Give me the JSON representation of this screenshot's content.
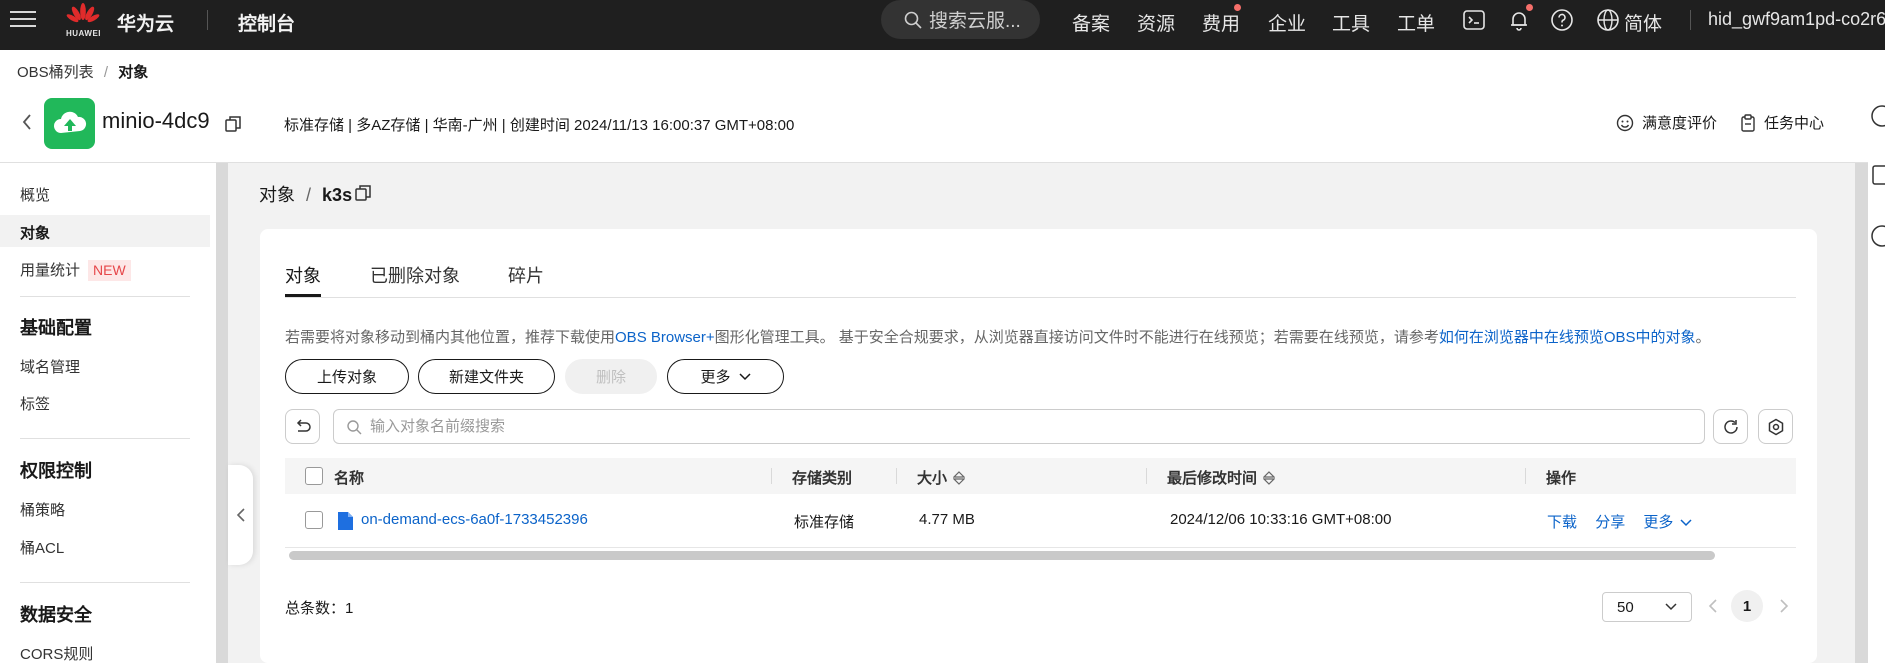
{
  "topbar": {
    "logo_text": "HUAWEI",
    "brand": "华为云",
    "console": "控制台",
    "search_placeholder": "搜索云服...",
    "nav": [
      "备案",
      "资源",
      "费用",
      "企业",
      "工具",
      "工单"
    ],
    "language": "简体",
    "user": "hid_gwf9am1pd-co2r6"
  },
  "breadcrumb": {
    "parent": "OBS桶列表",
    "separator": "/",
    "current": "对象"
  },
  "bucket": {
    "name": "minio-4dc9",
    "meta": "标准存储 | 多AZ存储 | 华南-广州 | 创建时间  2024/11/13 16:00:37 GMT+08:00",
    "satisfaction": "满意度评价",
    "task_center": "任务中心"
  },
  "sidebar": {
    "overview": "概览",
    "objects": "对象",
    "usage": "用量统计",
    "usage_badge": "NEW",
    "basic_config": "基础配置",
    "domain_mgmt": "域名管理",
    "tags": "标签",
    "access_control": "权限控制",
    "bucket_policy": "桶策略",
    "bucket_acl": "桶ACL",
    "data_security": "数据安全",
    "cors": "CORS规则"
  },
  "path": {
    "root": "对象",
    "separator": "/",
    "folder": "k3s"
  },
  "tabs": [
    "对象",
    "已删除对象",
    "碎片"
  ],
  "hint": {
    "prefix": "若需要将对象移动到桶内其他位置，推荐下载使用",
    "link1": "OBS Browser+",
    "middle": "图形化管理工具。 基于安全合规要求，从浏览器直接访问文件时不能进行在线预览；若需要在线预览，请参考",
    "link2": "如何在浏览器中在线预览OBS中的对象",
    "suffix": "。"
  },
  "actions": {
    "upload": "上传对象",
    "new_folder": "新建文件夹",
    "delete": "删除",
    "more": "更多"
  },
  "search": {
    "placeholder": "输入对象名前缀搜索"
  },
  "table": {
    "headers": {
      "name": "名称",
      "storage_class": "存储类别",
      "size": "大小",
      "modified": "最后修改时间",
      "ops": "操作"
    },
    "rows": [
      {
        "name": "on-demand-ecs-6a0f-1733452396",
        "storage_class": "标准存储",
        "size": "4.77 MB",
        "modified": "2024/12/06 10:33:16 GMT+08:00",
        "download": "下载",
        "share": "分享",
        "more": "更多"
      }
    ]
  },
  "footer": {
    "total_label": "总条数：",
    "total": "1",
    "page_size": "50",
    "current_page": "1"
  },
  "colors": {
    "topbar": "#1f1f1f",
    "link": "#0b63c9",
    "bucket_icon": "#21b85a",
    "badge": "#e6474a"
  }
}
